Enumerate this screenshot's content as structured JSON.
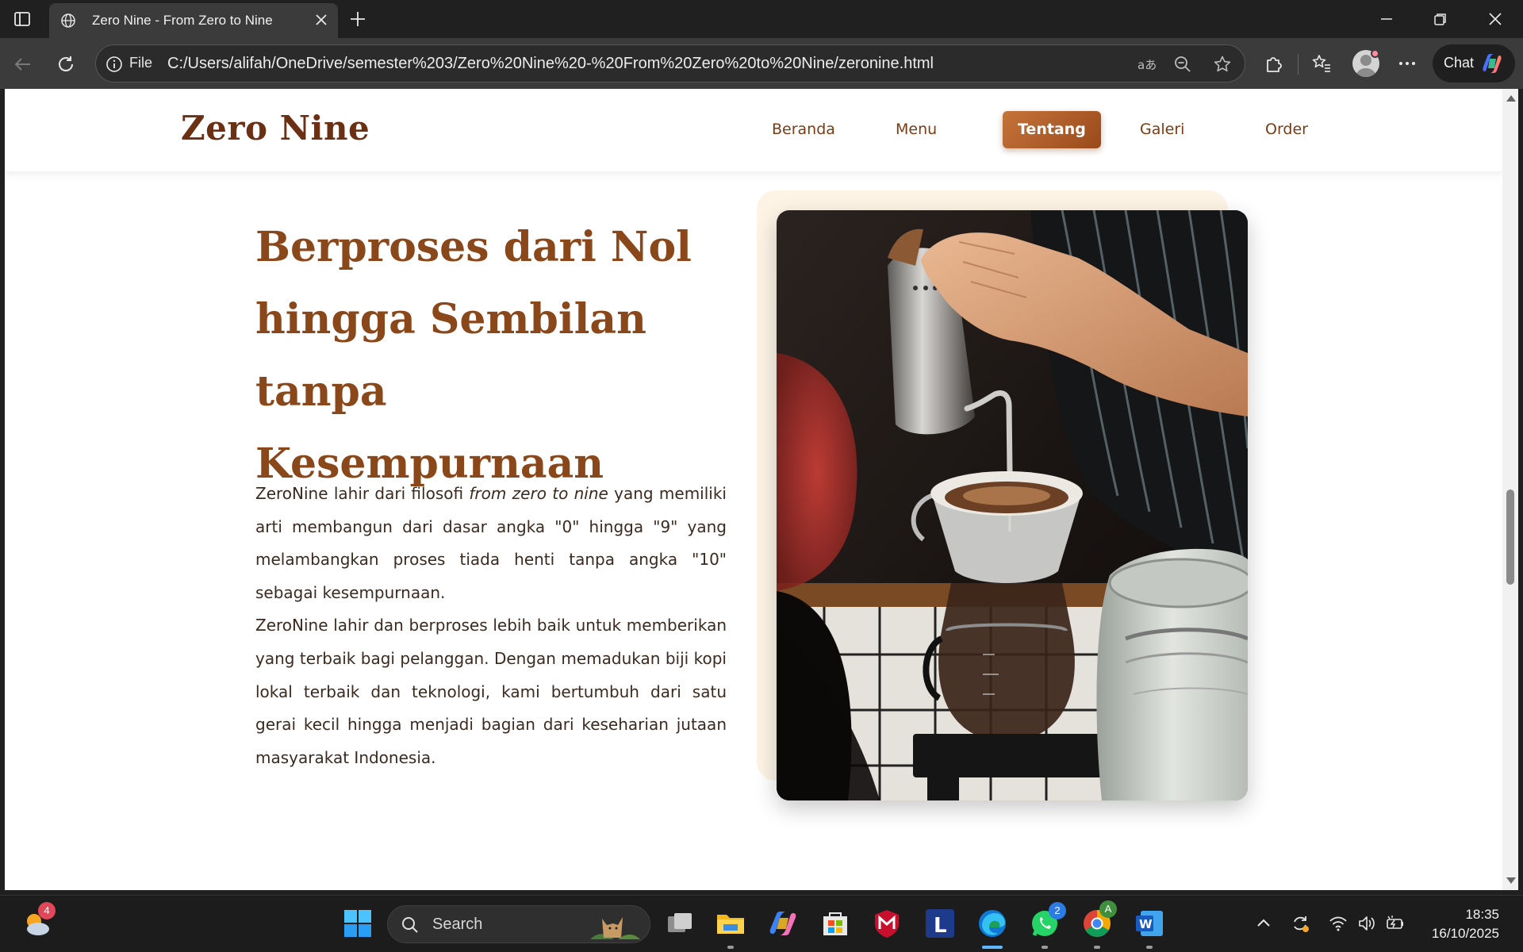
{
  "browser": {
    "tab_title": "Zero Nine - From Zero to Nine",
    "address_scheme": "File",
    "url": "C:/Users/alifah/OneDrive/semester%203/Zero%20Nine%20-%20From%20Zero%20to%20Nine/zeronine.html",
    "chat_label": "Chat"
  },
  "site": {
    "logo": "Zero Nine",
    "nav": [
      "Beranda",
      "Menu",
      "Tentang",
      "Galeri",
      "Order"
    ],
    "active_nav": "Tentang"
  },
  "about": {
    "title": "Berproses dari Nol hingga Sembilan tanpa Kesempurnaan",
    "para1_before": "ZeroNine lahir dari filosofi ",
    "para1_emph": "from zero to nine",
    "para1_after": " yang memiliki arti membangun dari dasar angka \"0\" hingga \"9\" yang melambangkan proses tiada henti tanpa angka \"10\" sebagai kesempurnaan.",
    "para2": "ZeroNine lahir dan berproses lebih baik untuk memberikan yang terbaik bagi pelanggan. Dengan memadukan biji kopi lokal terbaik dan teknologi, kami bertumbuh dari satu gerai kecil hingga menjadi bagian dari keseharian jutaan masyarakat Indonesia.",
    "image_subject": "barista pouring water from a gooseneck kettle into a pour-over coffee dripper"
  },
  "taskbar": {
    "search_placeholder": "Search",
    "weather_badge": "4",
    "whatsapp_badge": "2",
    "chrome_badge": "A",
    "time": "18:35",
    "date": "16/10/2025"
  },
  "colors": {
    "brand_dark": "#6b2f14",
    "brand": "#8a4719",
    "nav_active_start": "#c4743a",
    "nav_active_end": "#9a4a19",
    "photo_backdrop": "#fdf4e6"
  }
}
